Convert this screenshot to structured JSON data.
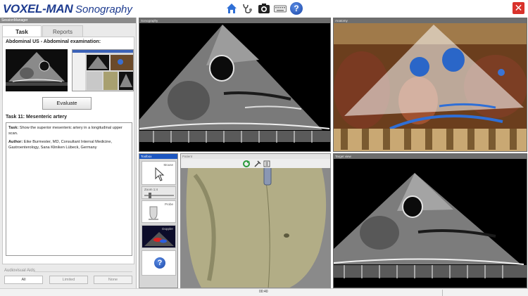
{
  "app": {
    "brand": "VOXEL-MAN",
    "product": "Sonography"
  },
  "toolbar": {
    "icons": [
      "home-icon",
      "stethoscope-icon",
      "camera-icon",
      "keyboard-icon",
      "help-icon",
      "close-icon"
    ]
  },
  "left_panel": {
    "title": "SessionManager",
    "tabs": [
      {
        "label": "Task",
        "active": true
      },
      {
        "label": "Reports",
        "active": false
      }
    ],
    "exam_title": "Abdominal US - Abdominal examination:",
    "evaluate_label": "Evaluate",
    "task_heading": "Task 11: Mesenteric artery",
    "task_label": "Task:",
    "task_text": "Show the superior mesenteric artery in a longitudinal upper scan.",
    "author_label": "Author:",
    "author_text": "Eike Burmester, MD, Consultant Internal Medicine, Gastroenterology, Sana Kliniken Lübeck, Germany",
    "audiovisual_label": "Audiovisual Aids",
    "audiovisual_options": [
      "All",
      "Limited",
      "None"
    ]
  },
  "viewports": {
    "sonography_title": "Sonography",
    "anatomy_title": "Anatomy",
    "toolbox_title": "Toolbox",
    "body_title": "Patient",
    "target_title": "Target view"
  },
  "toolbox": {
    "mouse_label": "Mouse",
    "zoom_label": "Zoom 1:4",
    "probe_label": "Probe",
    "doppler_label": "Doppler"
  },
  "status": {
    "time": "00:40"
  },
  "colors": {
    "brand": "#1d3b8f",
    "close": "#d9322b",
    "toolbox_header": "#1c56c0"
  }
}
